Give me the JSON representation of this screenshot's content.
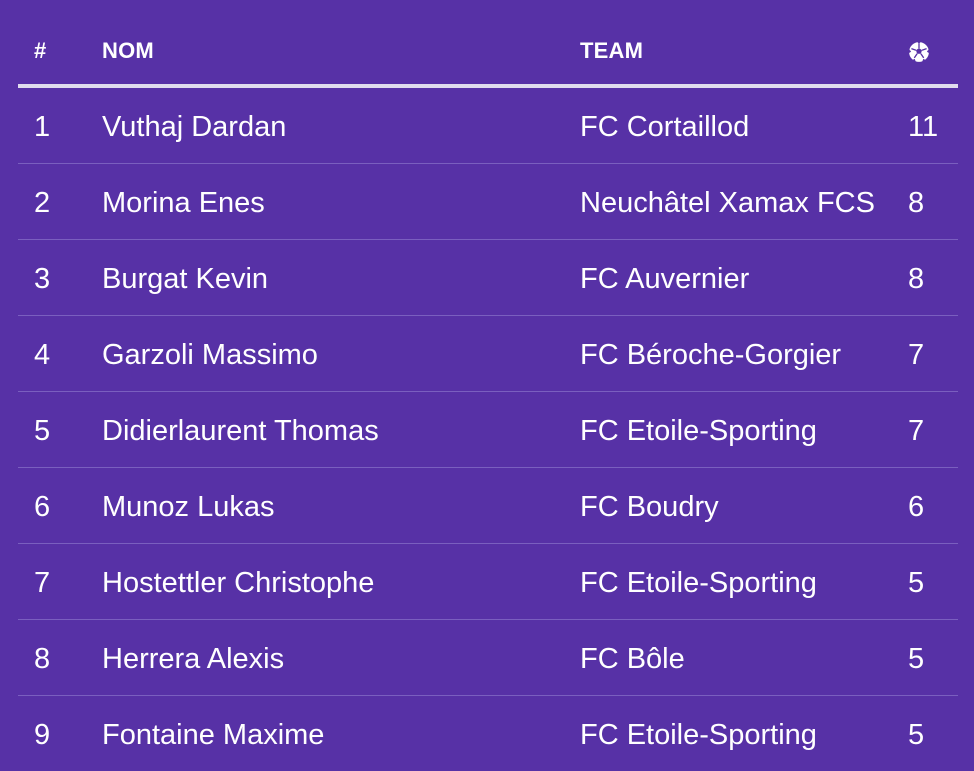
{
  "header": {
    "rank": "#",
    "name": "NOM",
    "team": "TEAM",
    "goals_icon": "soccer-ball-icon"
  },
  "rows": [
    {
      "rank": "1",
      "name": "Vuthaj Dardan",
      "team": "FC Cortaillod",
      "goals": "11"
    },
    {
      "rank": "2",
      "name": "Morina Enes",
      "team": "Neuchâtel Xamax FCS",
      "goals": "8"
    },
    {
      "rank": "3",
      "name": "Burgat Kevin",
      "team": "FC Auvernier",
      "goals": "8"
    },
    {
      "rank": "4",
      "name": "Garzoli Massimo",
      "team": "FC Béroche-Gorgier",
      "goals": "7"
    },
    {
      "rank": "5",
      "name": "Didierlaurent Thomas",
      "team": "FC Etoile-Sporting",
      "goals": "7"
    },
    {
      "rank": "6",
      "name": "Munoz Lukas",
      "team": "FC Boudry",
      "goals": "6"
    },
    {
      "rank": "7",
      "name": "Hostettler Christophe",
      "team": "FC Etoile-Sporting",
      "goals": "5"
    },
    {
      "rank": "8",
      "name": "Herrera Alexis",
      "team": "FC Bôle",
      "goals": "5"
    },
    {
      "rank": "9",
      "name": "Fontaine Maxime",
      "team": "FC Etoile-Sporting",
      "goals": "5"
    }
  ],
  "colors": {
    "background": "#5731a6",
    "text": "#ffffff",
    "header_rule": "#e0dcee",
    "row_divider": "#7a5fbf"
  }
}
